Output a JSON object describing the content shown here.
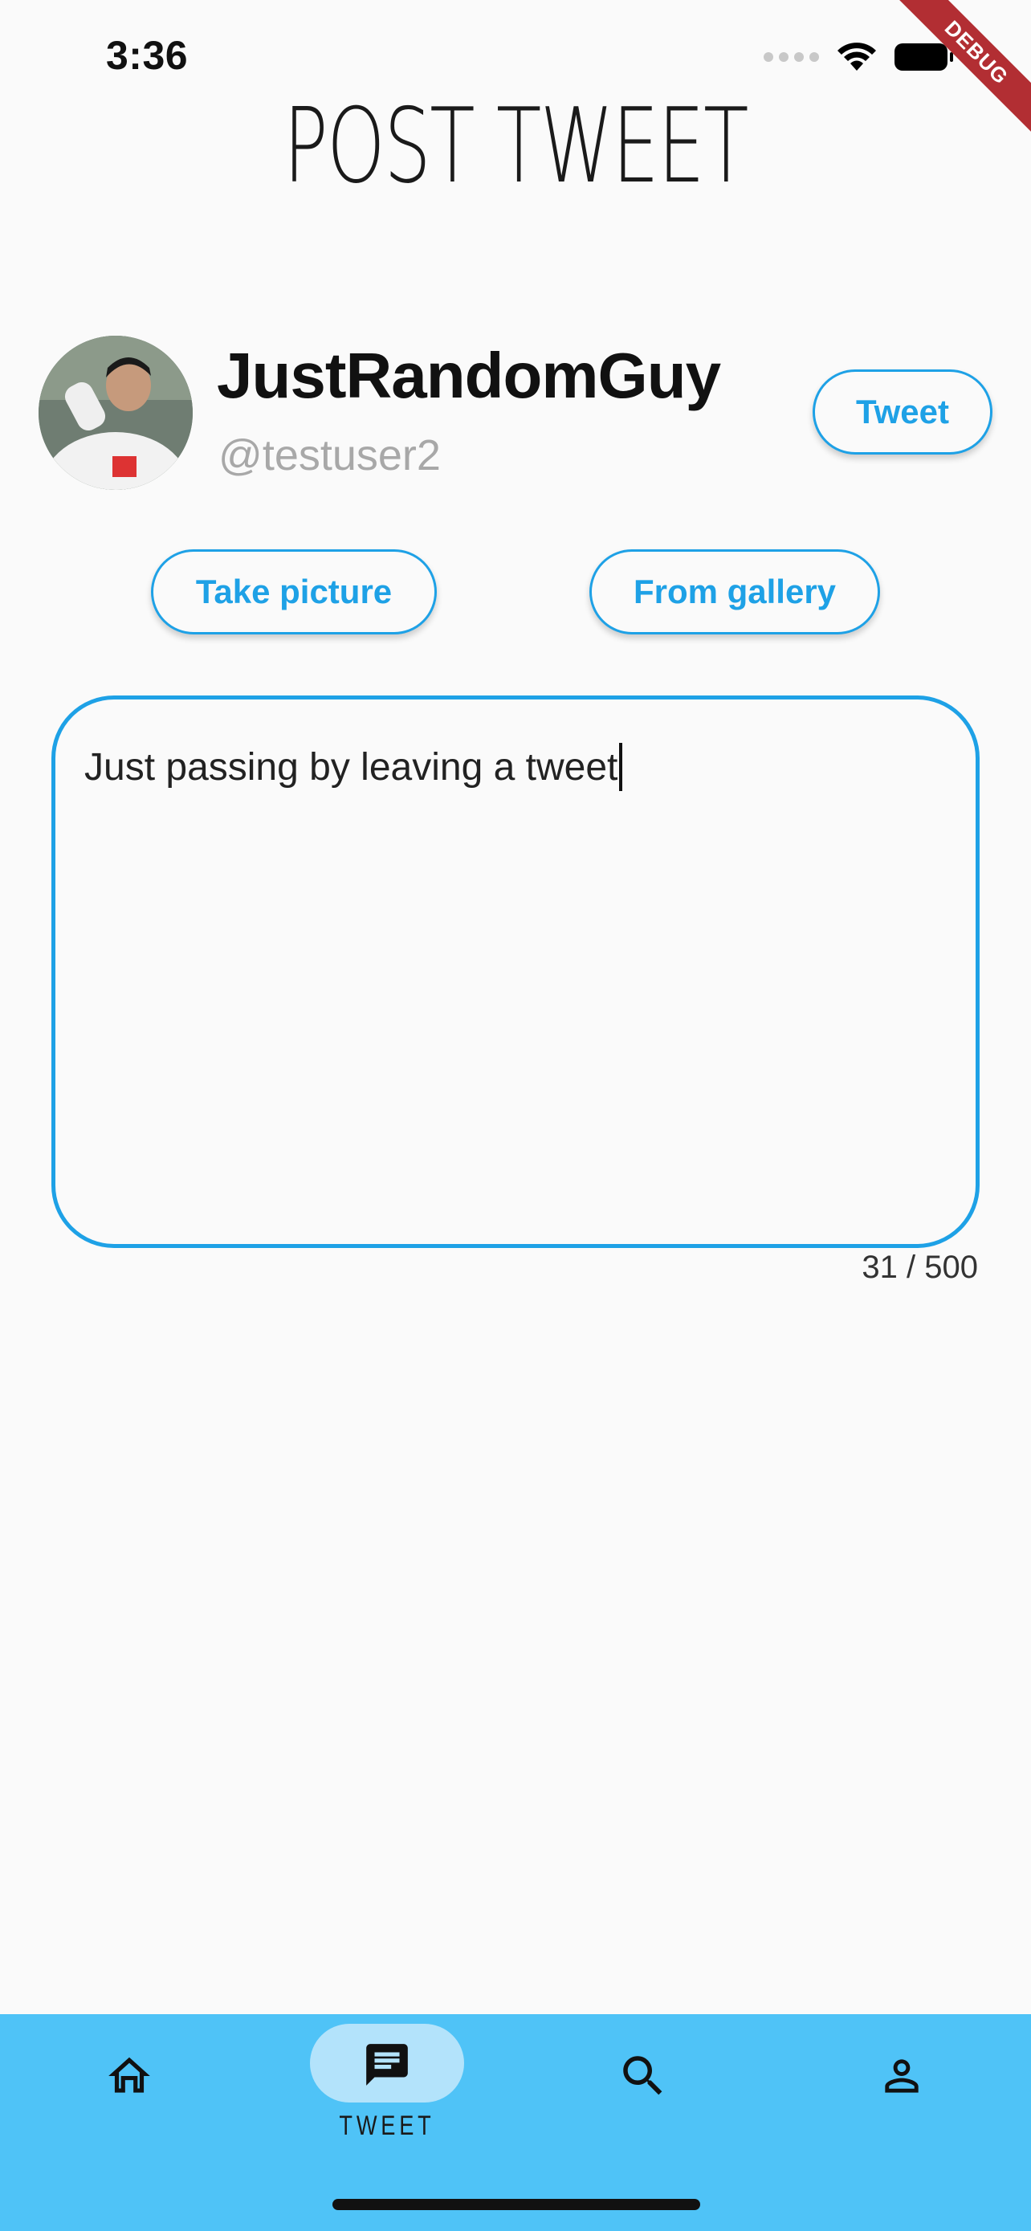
{
  "status_bar": {
    "time": "3:36"
  },
  "debug_banner": "DEBUG",
  "page": {
    "title": "POST TWEET"
  },
  "user": {
    "name": "JustRandomGuy",
    "handle": "@testuser2"
  },
  "actions": {
    "tweet_label": "Tweet",
    "take_picture_label": "Take picture",
    "from_gallery_label": "From gallery"
  },
  "composer": {
    "value": "Just passing by leaving a tweet",
    "counter": "31 / 500"
  },
  "bottom_nav": {
    "items": [
      {
        "icon": "home-icon",
        "label": ""
      },
      {
        "icon": "chat-icon",
        "label": "TWEET",
        "selected": true
      },
      {
        "icon": "search-icon",
        "label": ""
      },
      {
        "icon": "person-icon",
        "label": ""
      }
    ]
  },
  "colors": {
    "accent": "#1ea1e6",
    "nav_bg": "#4fc3f7",
    "nav_pill": "#b3e3fb",
    "debug": "#b22e33"
  }
}
